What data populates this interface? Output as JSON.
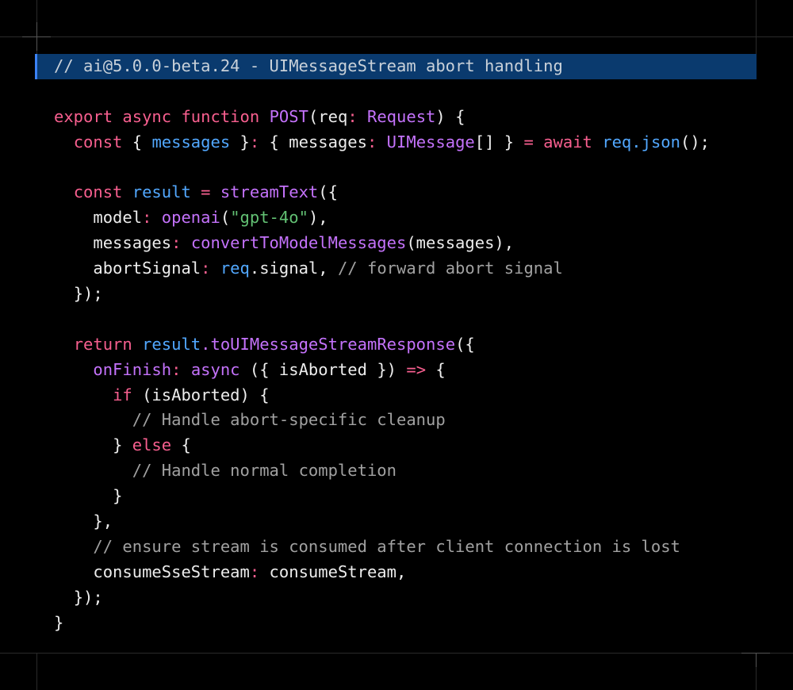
{
  "colors": {
    "background": "#000000",
    "highlight_bg": "#0a3a6e",
    "highlight_border": "#3b82f6",
    "keyword": "#f75f8f",
    "function": "#c472fb",
    "variable": "#52a8ff",
    "string": "#62c073",
    "comment": "#a1a1a1",
    "plain": "#ededed"
  },
  "code": {
    "header_comment": "// ai@5.0.0-beta.24 - UIMessageStream abort handling",
    "l1": {
      "export": "export",
      "async": "async",
      "function": "function",
      "name": "POST",
      "open": "(req",
      "colon": ":",
      "type": "Request",
      "close": ") {"
    },
    "l2": {
      "const": "const",
      "b1": "{ ",
      "messages": "messages",
      "b2": " }",
      "colon": ":",
      "b3": " { messages",
      "colon2": ":",
      "type": "UIMessage",
      "b4": "[] } ",
      "eq": "=",
      "await": "await",
      "req": "req",
      "json": ".json",
      "end": "();"
    },
    "l4": {
      "const": "const",
      "result": "result",
      "eq": "=",
      "call": "streamText",
      "end": "({"
    },
    "l5": {
      "key": "model",
      "colon": ":",
      "fn": "openai",
      "open": "(",
      "str": "\"gpt-4o\"",
      "close": "),"
    },
    "l6": {
      "key": "messages",
      "colon": ":",
      "fn": "convertToModelMessages",
      "args": "(messages),"
    },
    "l7": {
      "key": "abortSignal",
      "colon": ":",
      "req": "req",
      "rest": ".signal, ",
      "comment": "// forward abort signal"
    },
    "l8": "});",
    "l10": {
      "return": "return",
      "obj": "result",
      "method": ".toUIMessageStreamResponse",
      "end": "({"
    },
    "l11": {
      "key": "onFinish",
      "colon": ":",
      "async": "async",
      "params": " ({ isAborted }) ",
      "arrow": "=>",
      "end": " {"
    },
    "l12": {
      "if": "if",
      "cond": " (isAborted) {"
    },
    "l13": "// Handle abort-specific cleanup",
    "l14": {
      "close": "} ",
      "else": "else",
      "open": " {"
    },
    "l15": "// Handle normal completion",
    "l16": "}",
    "l17": "},",
    "l18": "// ensure stream is consumed after client connection is lost",
    "l19": {
      "key": "consumeSseStream",
      "colon": ":",
      "val": " consumeStream,"
    },
    "l20": "});",
    "l21": "}"
  }
}
